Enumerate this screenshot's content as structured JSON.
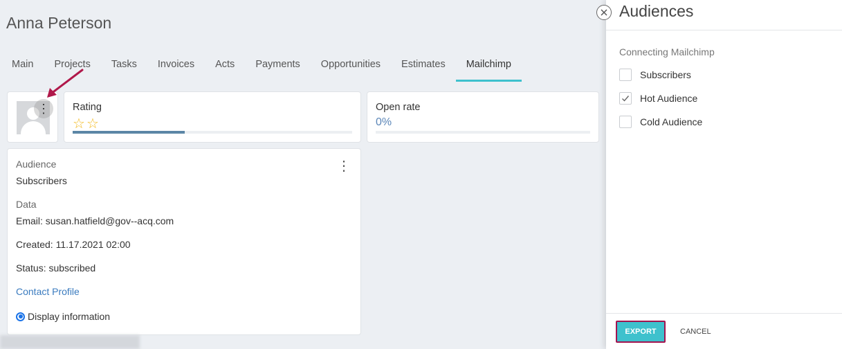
{
  "page": {
    "title": "Anna Peterson",
    "tabs": [
      {
        "label": "Main"
      },
      {
        "label": "Projects"
      },
      {
        "label": "Tasks"
      },
      {
        "label": "Invoices"
      },
      {
        "label": "Acts"
      },
      {
        "label": "Payments"
      },
      {
        "label": "Opportunities"
      },
      {
        "label": "Estimates"
      },
      {
        "label": "Mailchimp",
        "active": true
      }
    ]
  },
  "rating": {
    "label": "Rating",
    "stars_shown": 2,
    "icon": "star-outline-icon",
    "progress_fraction": 0.4
  },
  "open_rate": {
    "label": "Open rate",
    "value": "0%"
  },
  "audience_card": {
    "audience_label": "Audience",
    "audience_value": "Subscribers",
    "data_label": "Data",
    "email": "Email: susan.hatfield@gov--acq.com",
    "created": "Created: 11.17.2021 02:00",
    "status": "Status: subscribed",
    "contact_link": "Contact Profile",
    "display_info": "Display information"
  },
  "panel": {
    "title": "Audiences",
    "section_label": "Connecting Mailchimp",
    "options": [
      {
        "label": "Subscribers",
        "checked": false
      },
      {
        "label": "Hot Audience",
        "checked": true
      },
      {
        "label": "Cold Audience",
        "checked": false
      }
    ],
    "export_label": "EXPORT",
    "cancel_label": "CANCEL"
  },
  "colors": {
    "accent": "#3ec1cd",
    "highlight_border": "#a3134f",
    "link": "#3a7bbf",
    "star": "#f3b81b",
    "annotation_arrow": "#b0184a"
  }
}
